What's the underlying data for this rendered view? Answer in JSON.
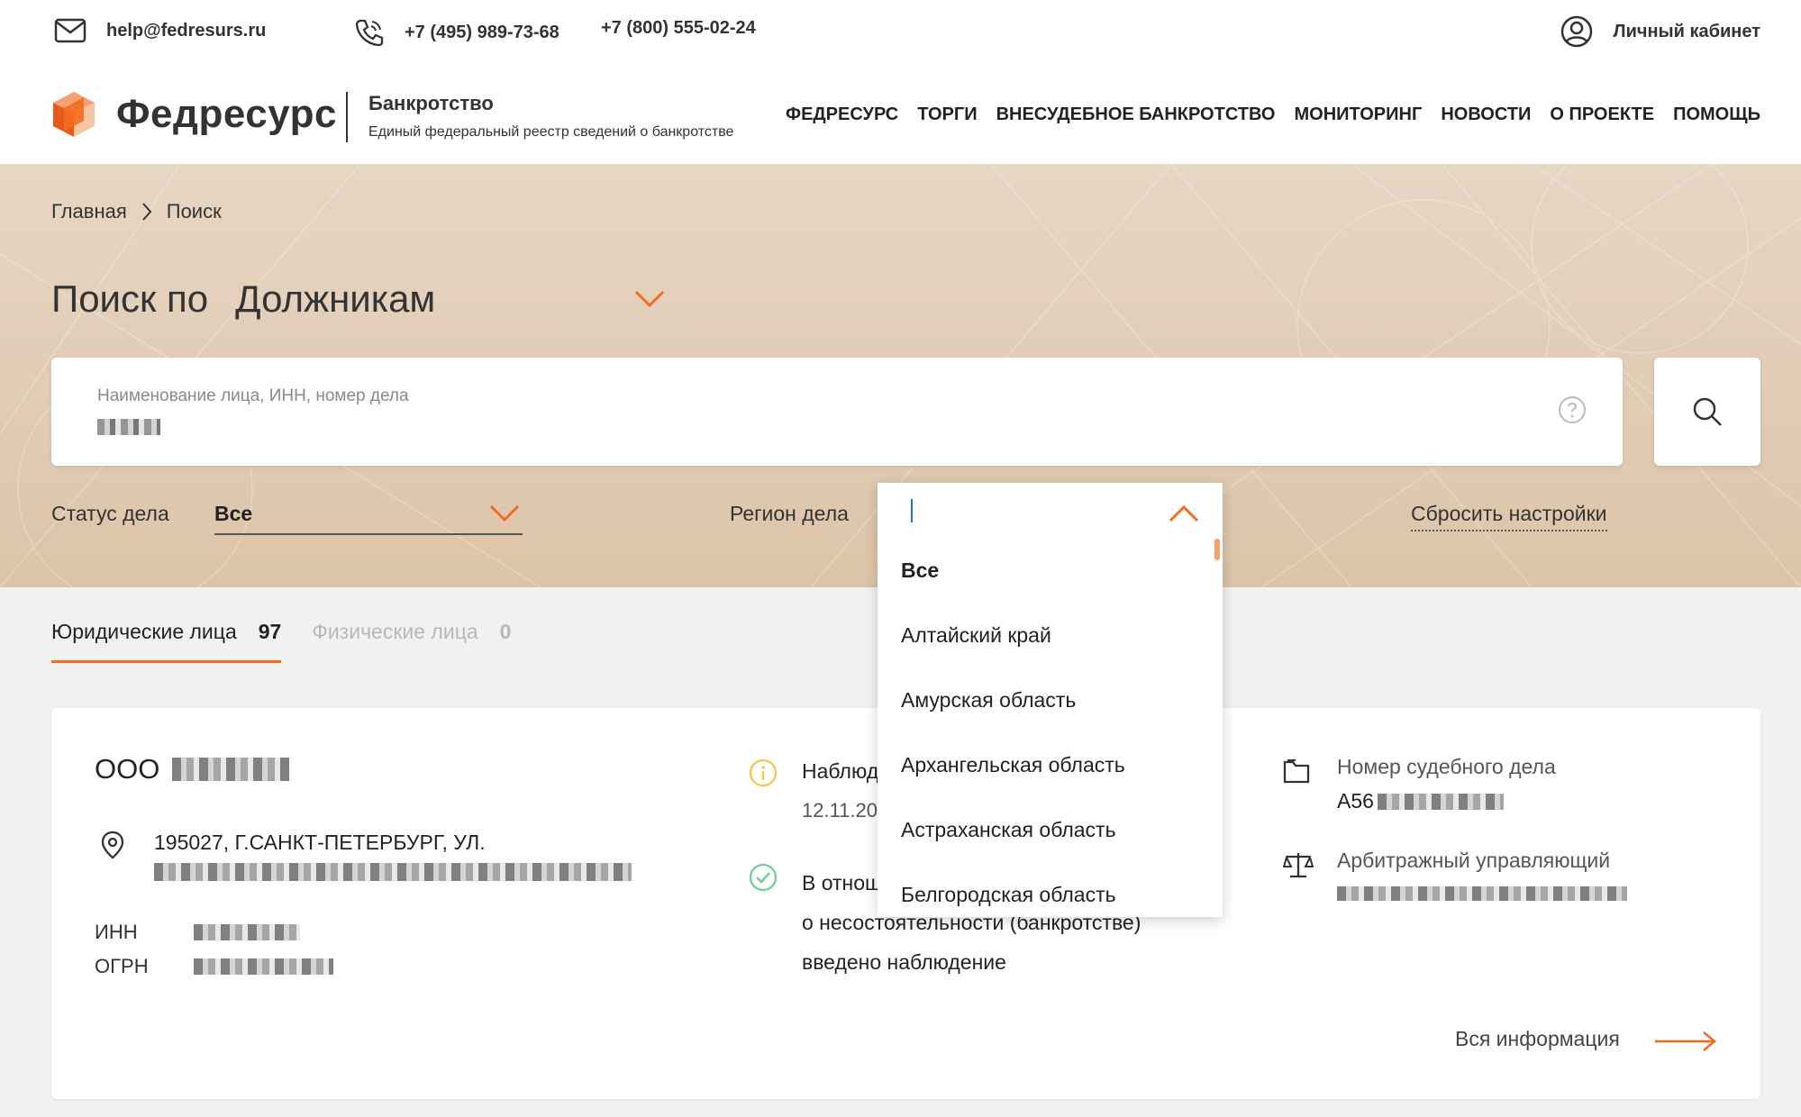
{
  "topbar": {
    "email": "help@fedresurs.ru",
    "phone1": "+7 (495) 989-73-68",
    "phone2": "+7 (800) 555-02-24",
    "account": "Личный кабинет"
  },
  "header": {
    "logo": "Федресурс",
    "section_title": "Банкротство",
    "section_subtitle": "Единый федеральный реестр сведений о банкротстве",
    "nav": [
      "ФЕДРЕСУРС",
      "ТОРГИ",
      "ВНЕСУДЕБНОЕ БАНКРОТСТВО",
      "МОНИТОРИНГ",
      "НОВОСТИ",
      "О ПРОЕКТЕ",
      "ПОМОЩЬ"
    ]
  },
  "breadcrumbs": [
    "Главная",
    "Поиск"
  ],
  "search": {
    "title_prefix": "Поиск по",
    "mode": "Должникам",
    "placeholder": "Наименование лица, ИНН, номер дела",
    "search_icon": "search-icon"
  },
  "filters": {
    "status_label": "Статус дела",
    "status_value": "Все",
    "region_label": "Регион дела",
    "reset_label": "Сбросить настройки"
  },
  "region_dropdown": {
    "items": [
      "Все",
      "Алтайский край",
      "Амурская область",
      "Архангельская область",
      "Астраханская область",
      "Белгородская область"
    ],
    "selected": "Все"
  },
  "tabs": [
    {
      "label": "Юридические лица",
      "count": "97",
      "active": true
    },
    {
      "label": "Физические лица",
      "count": "0",
      "active": false
    }
  ],
  "result": {
    "name_prefix": "ООО",
    "address": "195027, Г.САНКТ-ПЕТЕРБУРГ, УЛ.",
    "inn_label": "ИНН",
    "ogrn_label": "ОГРН",
    "stage": "Наблюд",
    "date": "12.11.20",
    "message_lines": [
      "В отнош",
      "о несостоятельности (банкротстве)",
      "введено наблюдение"
    ],
    "case_label": "Номер судебного дела",
    "case_prefix": "А56",
    "arbiter_label": "Арбитражный управляющий",
    "more_label": "Вся информация"
  },
  "colors": {
    "accent": "#f26b21",
    "hero_bg": "#e2ccb3",
    "info_yellow": "#f2c94c",
    "ok_green": "#6fcf97"
  }
}
